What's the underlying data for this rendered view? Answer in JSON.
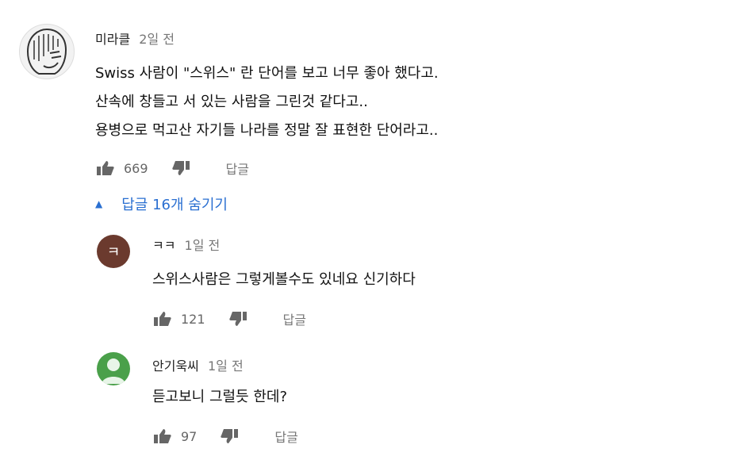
{
  "thread": {
    "author": "미라클",
    "time": "2일 전",
    "lines": [
      "Swiss 사람이 \"스위스\" 란 단어를 보고 너무 좋아 했다고.",
      "산속에 창들고 서 있는 사람을 그린것 같다고..",
      "용병으로 먹고산 자기들 나라를 정말 잘 표현한 단어라고.."
    ],
    "likes": "669",
    "reply_label": "답글",
    "hide_replies_label": "답글 16개 숨기기"
  },
  "replies": [
    {
      "author": "ㅋㅋ",
      "time": "1일 전",
      "avatar_letter": "ㅋ",
      "avatar_color": "#6b3a2e",
      "text": "스위스사람은 그렇게볼수도 있네요 신기하다",
      "likes": "121",
      "reply_label": "답글"
    },
    {
      "author": "안기욱씨",
      "time": "1일 전",
      "avatar_color": "#4aa04a",
      "text": "듣고보니 그럴듯 한데?",
      "likes": "97",
      "reply_label": "답글"
    }
  ],
  "colors": {
    "link_blue": "#2a6fd1",
    "icon_gray": "#666666"
  }
}
